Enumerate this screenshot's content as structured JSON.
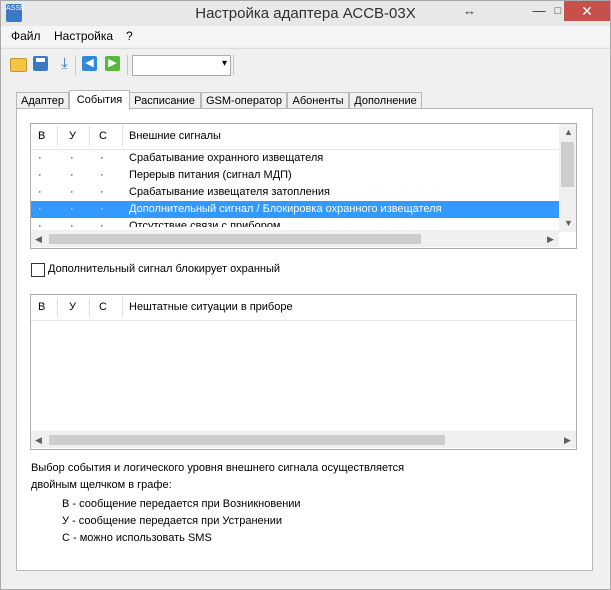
{
  "window": {
    "title": "Настройка адаптера АССВ-03Х",
    "icon_text": "ASSB",
    "resize_glyph": "↔",
    "minimize_glyph": "—",
    "maximize_glyph": "□",
    "close_glyph": "✕"
  },
  "menu": {
    "items": [
      "Файл",
      "Настройка",
      "?"
    ]
  },
  "toolbar": {
    "icons": [
      "open-folder-icon",
      "save-icon",
      "download-icon",
      "back-arrow-icon",
      "forward-arrow-icon"
    ],
    "download_glyph": "⤓",
    "back_glyph": "◀",
    "forward_glyph": "▶",
    "combo_value": "",
    "combo_arrow": "▾"
  },
  "tabs": {
    "items": [
      "Адаптер",
      "События",
      "Расписание",
      "GSM-оператор",
      "Абоненты",
      "Дополнение"
    ],
    "active": "События"
  },
  "signals_list": {
    "columns": [
      "В",
      "У",
      "С",
      "Внешние сигналы"
    ],
    "rows": [
      {
        "v": "·",
        "u": "·",
        "s": "·",
        "name": "Срабатывание охранного извещателя"
      },
      {
        "v": "·",
        "u": "·",
        "s": "·",
        "name": "Перерыв питания (сигнал МДП)"
      },
      {
        "v": "·",
        "u": "·",
        "s": "·",
        "name": "Срабатывание извещателя затопления"
      },
      {
        "v": "·",
        "u": "·",
        "s": "·",
        "name": "Дополнительный сигнал / Блокировка охранного извещателя",
        "selected": true
      },
      {
        "v": "·",
        "u": "·",
        "s": "·",
        "name": "Отсутствие связи с прибором"
      }
    ]
  },
  "checkbox": {
    "label": "Дополнительный сигнал блокирует охранный",
    "checked": false
  },
  "incidents_list": {
    "columns": [
      "В",
      "У",
      "С",
      "Нештатные ситуации в приборе"
    ],
    "rows": []
  },
  "scroll_glyphs": {
    "up": "▲",
    "down": "▼",
    "left": "◀",
    "right": "▶"
  },
  "info": {
    "line1": "Выбор события и логического уровня внешнего сигнала осуществляется",
    "line2": "двойным щелчком в графе:",
    "legend": [
      "В - сообщение передается при Возникновении",
      "У - сообщение передается при Устранении",
      "С - можно использовать SMS"
    ]
  },
  "colors": {
    "selection": "#3399ff",
    "close_button": "#c7504a"
  }
}
